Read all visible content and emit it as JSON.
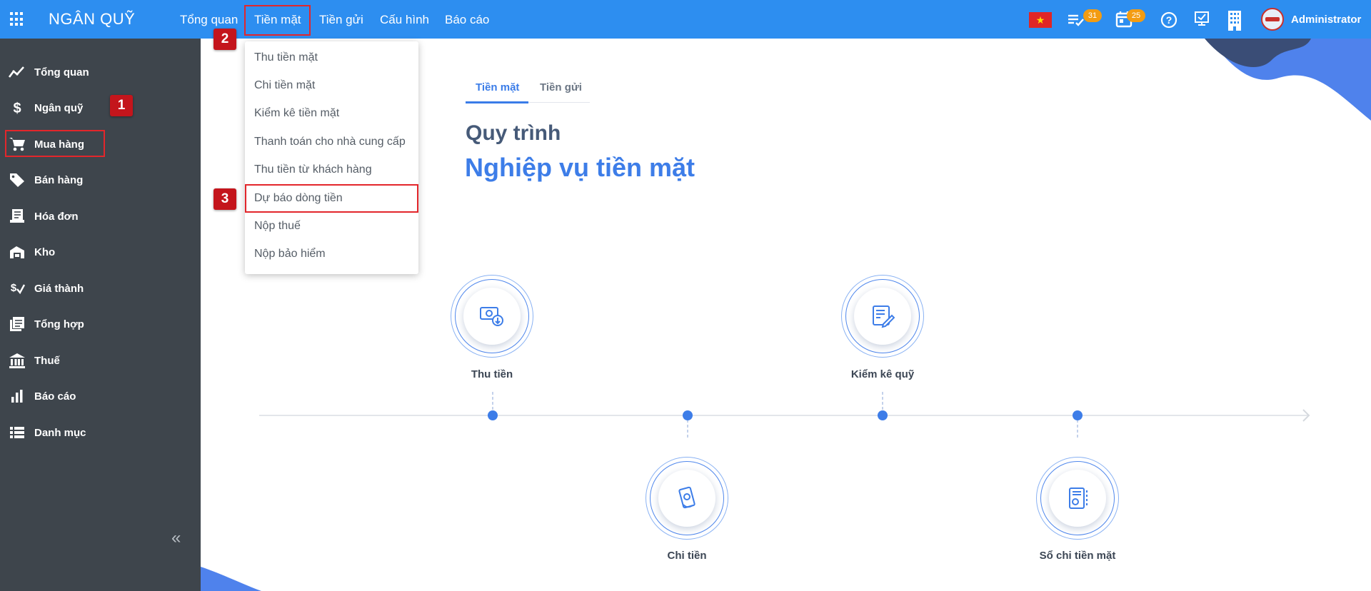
{
  "app": {
    "title": "NGÂN QUỸ"
  },
  "topnav": {
    "items": [
      {
        "label": "Tổng quan"
      },
      {
        "label": "Tiền mặt"
      },
      {
        "label": "Tiền gửi"
      },
      {
        "label": "Cấu hình"
      },
      {
        "label": "Báo cáo"
      }
    ]
  },
  "header_right": {
    "tasks_badge": "31",
    "calendar_badge": "25",
    "username": "Administrator"
  },
  "sidebar": {
    "items": [
      {
        "label": "Tổng quan",
        "icon": "trend-icon"
      },
      {
        "label": "Ngân quỹ",
        "icon": "dollar-icon"
      },
      {
        "label": "Mua hàng",
        "icon": "cart-icon"
      },
      {
        "label": "Bán hàng",
        "icon": "tag-icon"
      },
      {
        "label": "Hóa đơn",
        "icon": "receipt-icon"
      },
      {
        "label": "Kho",
        "icon": "warehouse-icon"
      },
      {
        "label": "Giá thành",
        "icon": "cost-icon"
      },
      {
        "label": "Tổng hợp",
        "icon": "ledger-icon"
      },
      {
        "label": "Thuế",
        "icon": "bank-icon"
      },
      {
        "label": "Báo cáo",
        "icon": "bar-chart-icon"
      },
      {
        "label": "Danh mục",
        "icon": "list-icon"
      }
    ],
    "collapse_label": "«"
  },
  "dropdown": {
    "items": [
      {
        "label": "Thu tiền mặt"
      },
      {
        "label": "Chi tiền mặt"
      },
      {
        "label": "Kiểm kê tiền mặt"
      },
      {
        "label": "Thanh toán cho nhà cung cấp"
      },
      {
        "label": "Thu tiền từ khách hàng"
      },
      {
        "label": "Dự báo dòng tiền"
      },
      {
        "label": "Nộp thuế"
      },
      {
        "label": "Nộp bảo hiểm"
      }
    ]
  },
  "markers": [
    "1",
    "2",
    "3"
  ],
  "main": {
    "tabs": [
      {
        "label": "Tiền mặt",
        "active": true
      },
      {
        "label": "Tiền gửi",
        "active": false
      }
    ],
    "heading_1": "Quy trình",
    "heading_2": "Nghiệp vụ tiền mặt",
    "process_steps": [
      {
        "label": "Thu tiền",
        "icon": "cash-in-icon"
      },
      {
        "label": "Chi tiền",
        "icon": "cash-out-icon"
      },
      {
        "label": "Kiểm kê quỹ",
        "icon": "audit-icon"
      },
      {
        "label": "Sổ chi tiền mặt",
        "icon": "cashbook-icon"
      }
    ]
  },
  "colors": {
    "topbar": "#2d8ef0",
    "sidebar": "#3e454c",
    "accent": "#3d7de8",
    "highlight": "#e3262b",
    "marker": "#c4151c"
  }
}
